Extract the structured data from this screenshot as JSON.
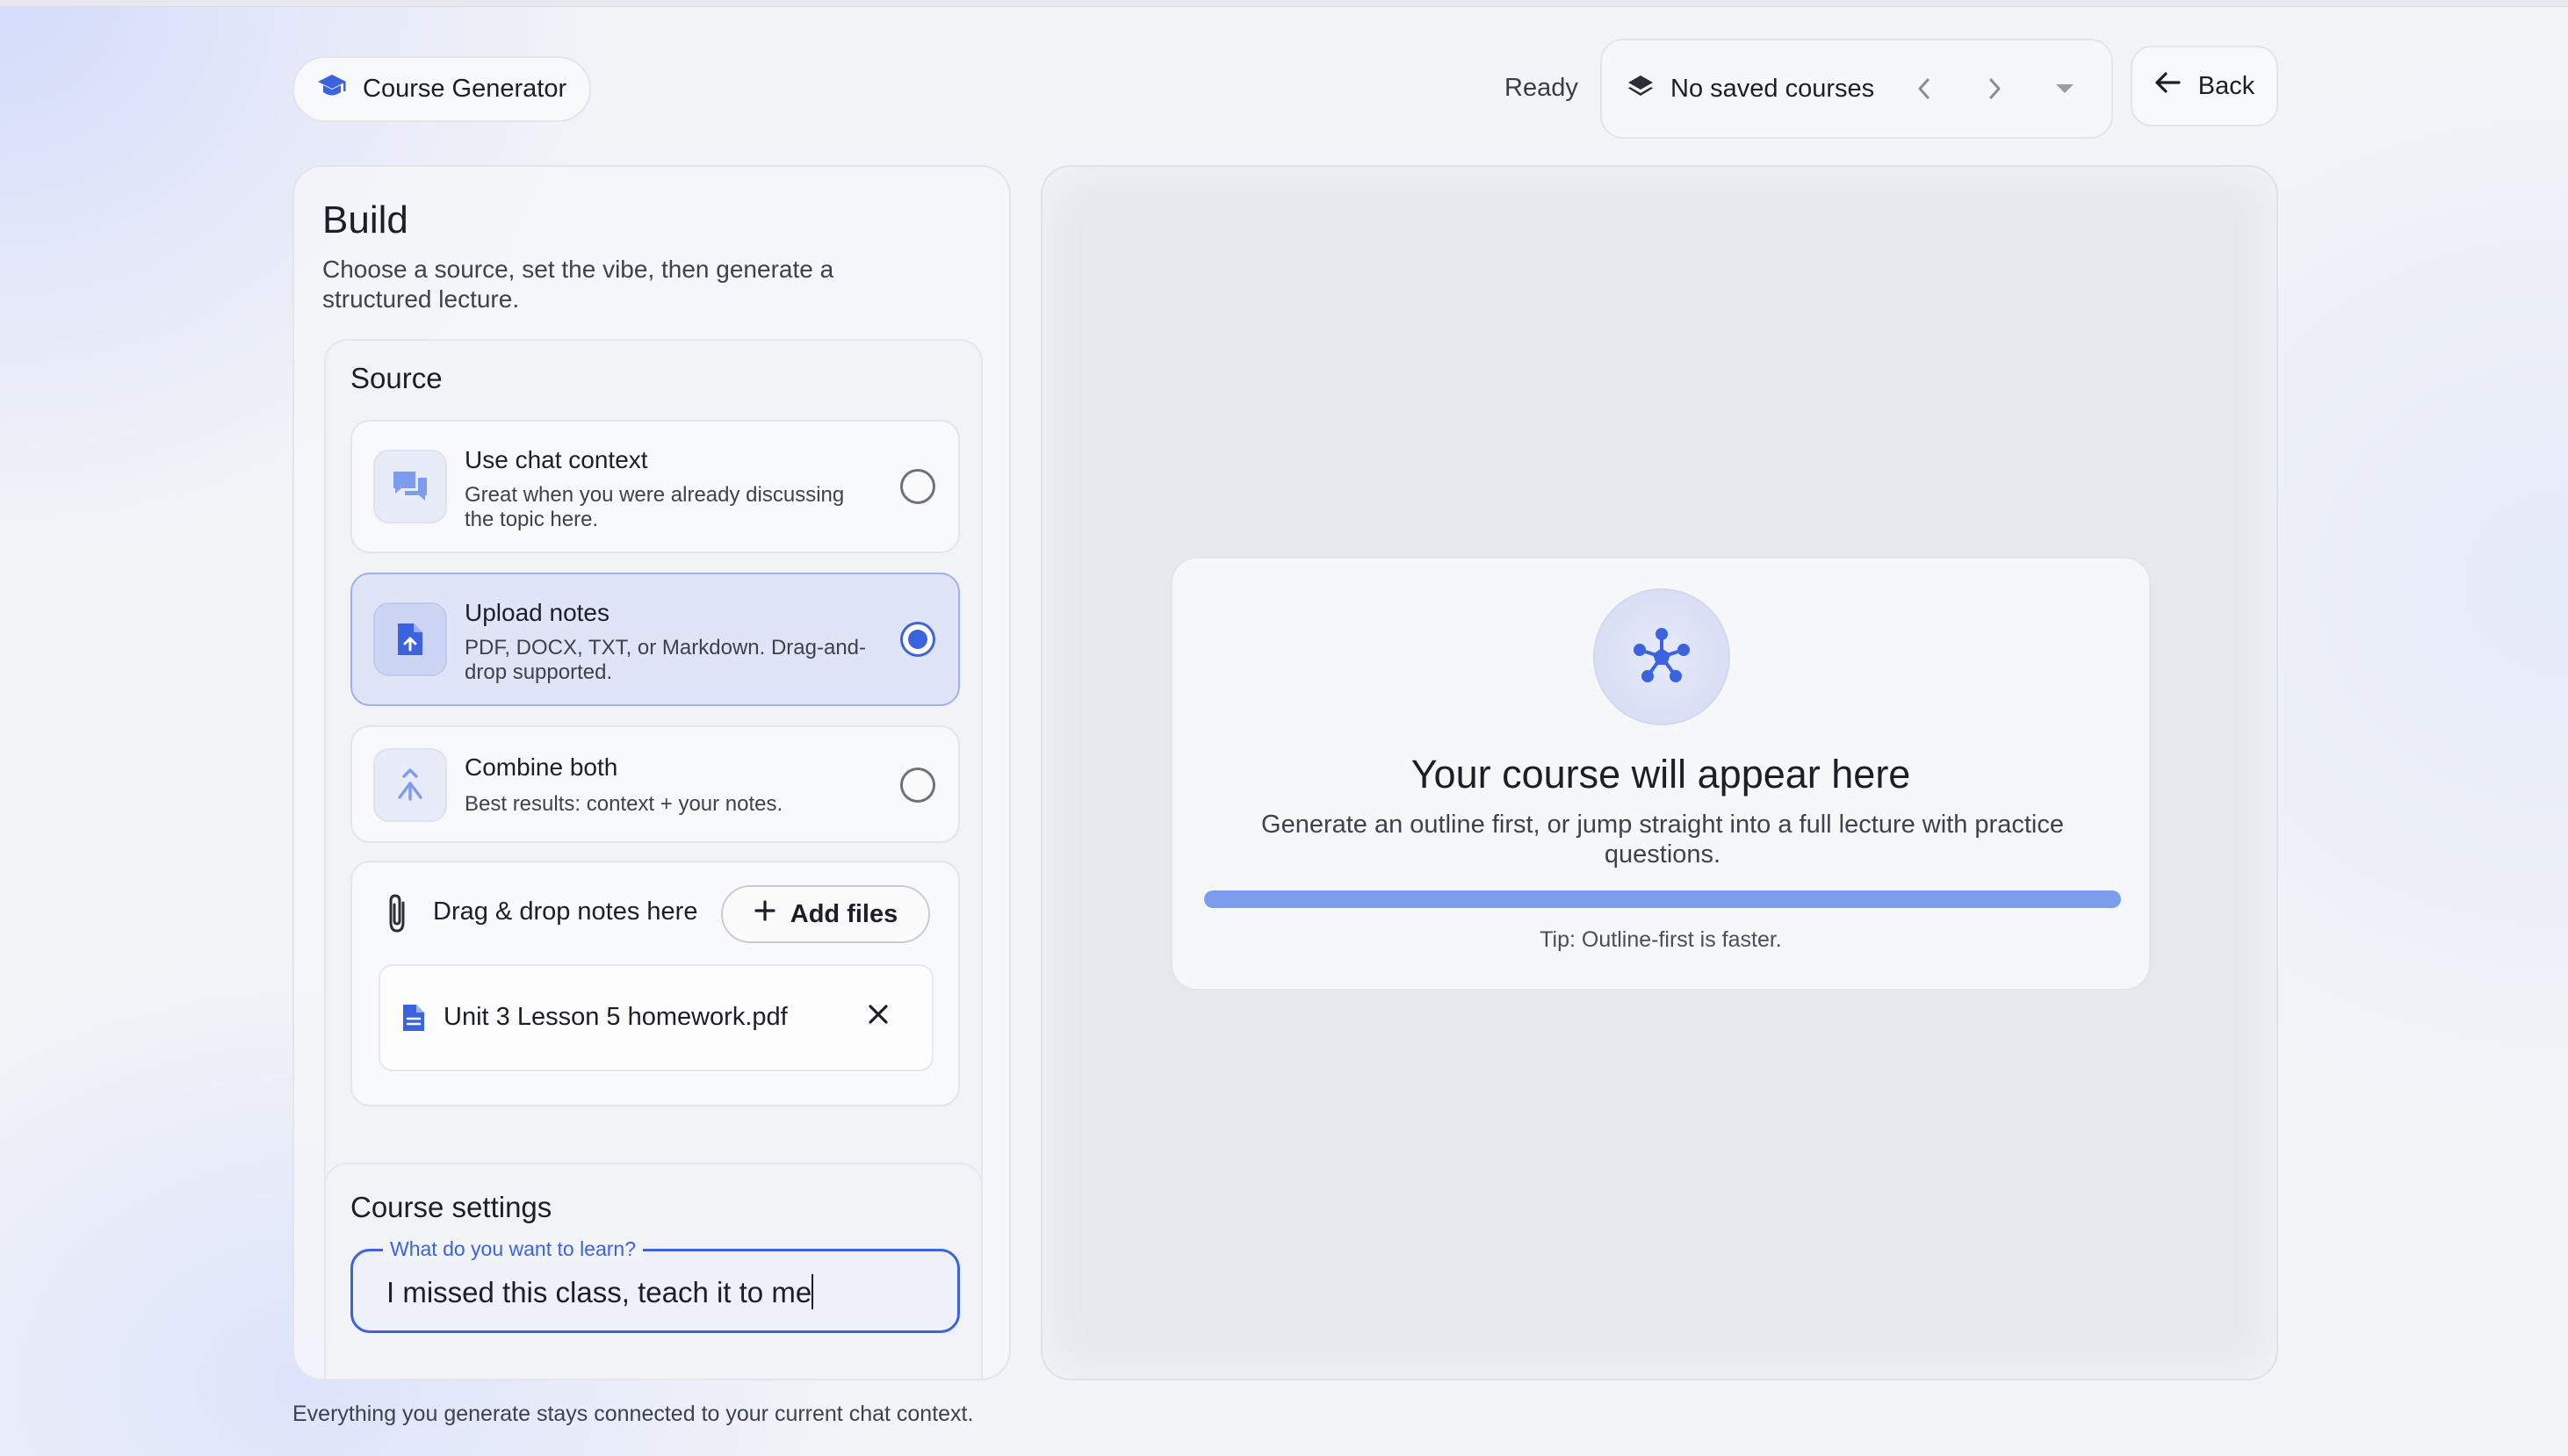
{
  "app": {
    "brand_label": "Course Generator",
    "brand_icon": "graduation-cap-icon"
  },
  "header": {
    "status": "Ready",
    "saved_courses_label": "No saved courses",
    "saved_courses_icon": "layers-icon",
    "back_label": "Back"
  },
  "build": {
    "title": "Build",
    "subtitle": "Choose a source, set the vibe, then generate a structured lecture.",
    "source": {
      "title": "Source",
      "options": [
        {
          "title": "Use chat context",
          "description": "Great when you were already discussing the topic here.",
          "icon": "chat-icon",
          "selected": false
        },
        {
          "title": "Upload notes",
          "description": "PDF, DOCX, TXT, or Markdown. Drag-and-drop supported.",
          "icon": "file-upload-icon",
          "selected": true
        },
        {
          "title": "Combine both",
          "description": "Best results: context + your notes.",
          "icon": "merge-icon",
          "selected": false
        }
      ],
      "drop_label": "Drag & drop notes here",
      "add_files_label": "Add files",
      "files": [
        {
          "name": "Unit 3 Lesson 5 homework.pdf"
        }
      ]
    },
    "settings": {
      "title": "Course settings",
      "learn_label": "What do you want to learn?",
      "learn_value": "I missed this class, teach it to me"
    }
  },
  "footer_note": "Everything you generate stays connected to your current chat context.",
  "preview": {
    "title": "Your course will appear here",
    "description": "Generate an outline first, or jump straight into a full lecture with practice questions.",
    "progress_fraction": 1.0,
    "tip": "Tip: Outline-first is faster."
  },
  "colors": {
    "accent": "#3b63e0",
    "progress": "#7d9cee",
    "selected_bg": "#dfe4f7"
  }
}
